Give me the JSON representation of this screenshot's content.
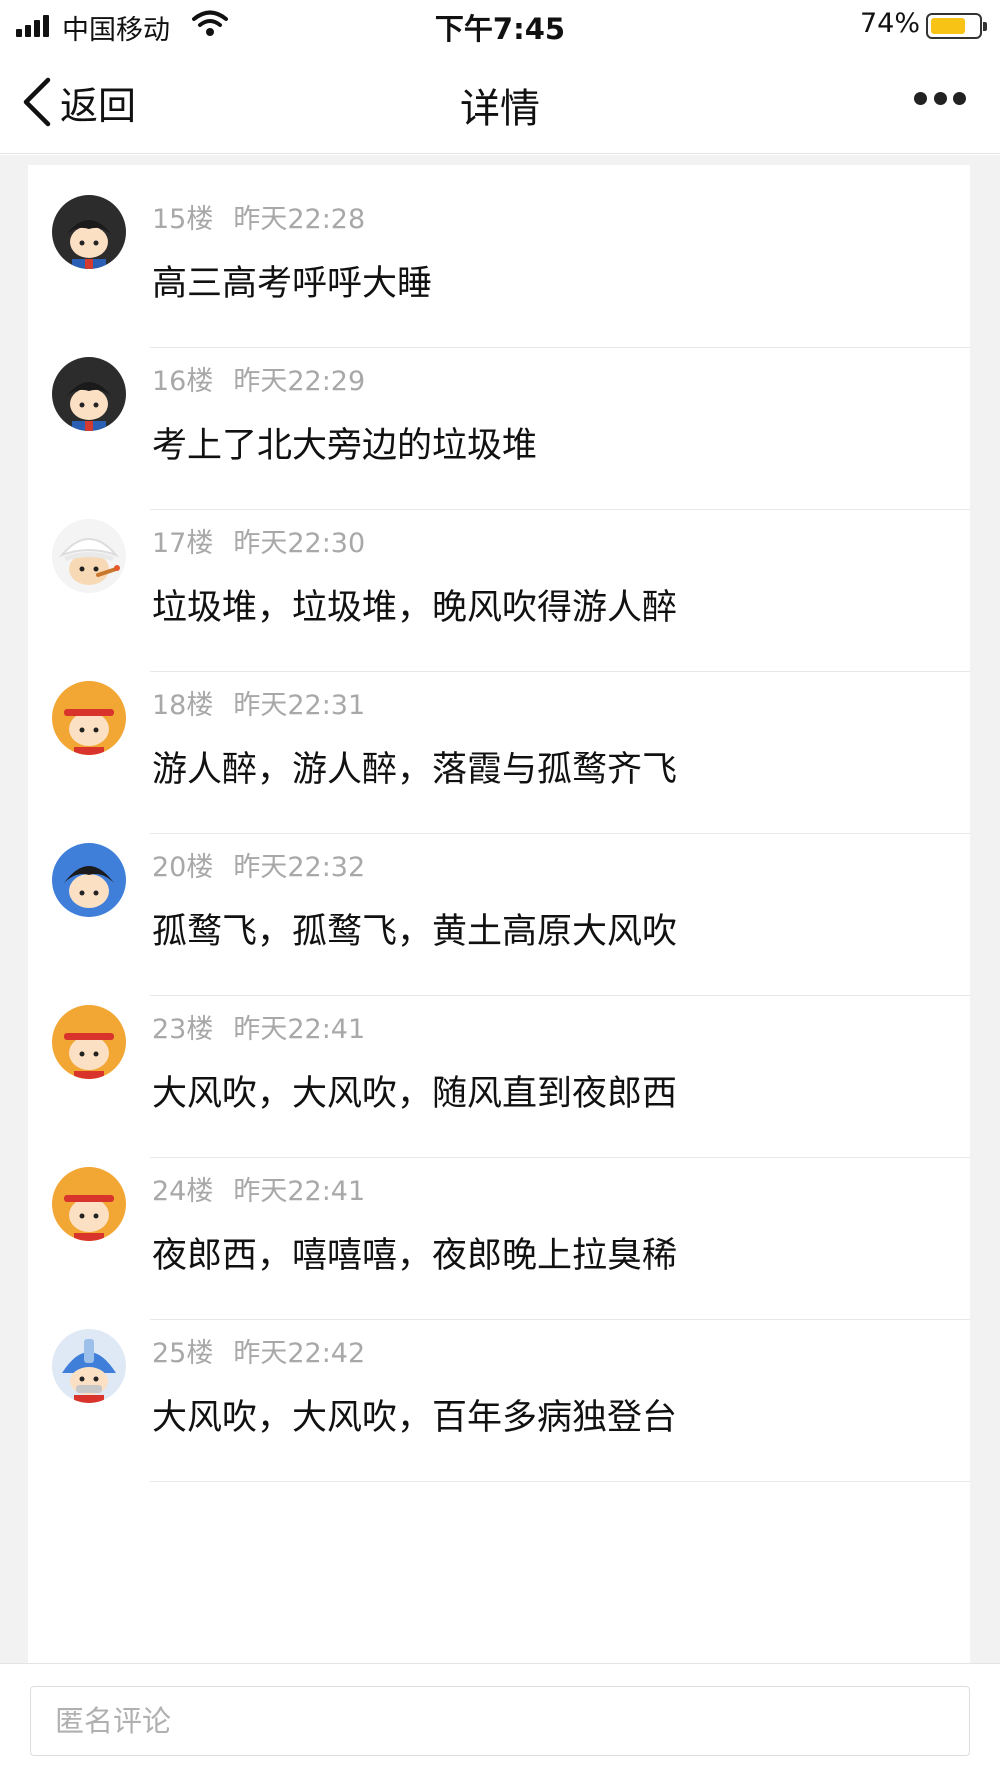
{
  "status_bar": {
    "carrier": "中国移动",
    "time": "下午7:45",
    "battery": "74%",
    "battery_level": 0.74
  },
  "nav": {
    "back_label": "返回",
    "title": "详情"
  },
  "comments": [
    {
      "floor": "15楼",
      "time": "昨天22:28",
      "text": "高三高考呼呼大睡",
      "avatar": "boy-black-hair"
    },
    {
      "floor": "16楼",
      "time": "昨天22:29",
      "text": "考上了北大旁边的垃圾堆",
      "avatar": "boy-black-hair"
    },
    {
      "floor": "17楼",
      "time": "昨天22:30",
      "text": "垃圾堆，垃圾堆，晚风吹得游人醉",
      "avatar": "turban-kid"
    },
    {
      "floor": "18楼",
      "time": "昨天22:31",
      "text": "游人醉，游人醉，落霞与孤鹜齐飞",
      "avatar": "headband-kid"
    },
    {
      "floor": "20楼",
      "time": "昨天22:32",
      "text": "孤鹜飞，孤鹜飞，黄土高原大风吹",
      "avatar": "blue-hair-kid"
    },
    {
      "floor": "23楼",
      "time": "昨天22:41",
      "text": "大风吹，大风吹，随风直到夜郎西",
      "avatar": "headband-kid"
    },
    {
      "floor": "24楼",
      "time": "昨天22:41",
      "text": "夜郎西，嘻嘻嘻，夜郎晚上拉臭稀",
      "avatar": "headband-kid"
    },
    {
      "floor": "25楼",
      "time": "昨天22:42",
      "text": "大风吹，大风吹，百年多病独登台",
      "avatar": "robot-kid"
    }
  ],
  "comment_input": {
    "placeholder": "匿名评论"
  },
  "colors": {
    "meta_text": "#a8a8a8",
    "background": "#f2f2f2",
    "battery_fill": "#f7c315"
  }
}
